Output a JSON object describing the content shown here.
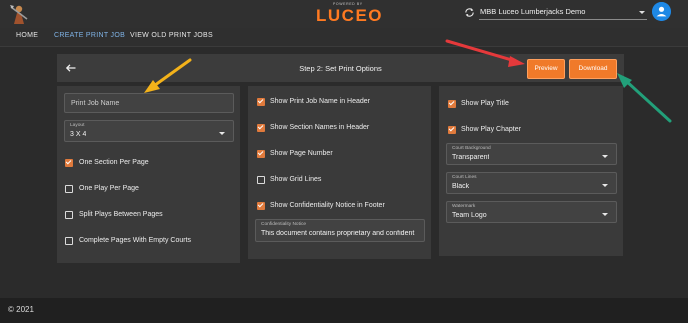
{
  "header": {
    "powered_by": "POWERED BY",
    "brand": "LUCEO",
    "team": "MBB Luceo Lumberjacks Demo"
  },
  "nav": {
    "items": [
      "HOME",
      "CREATE PRINT JOB",
      "VIEW OLD PRINT JOBS"
    ],
    "active_index": 1
  },
  "step": {
    "title": "Step 2: Set Print Options",
    "preview_label": "Preview",
    "download_label": "Download"
  },
  "panel1": {
    "job_name_placeholder": "Print Job Name",
    "layout_label": "Layout",
    "layout_value": "3 X 4",
    "options": [
      {
        "label": "One Section Per Page",
        "checked": true
      },
      {
        "label": "One Play Per Page",
        "checked": false
      },
      {
        "label": "Split Plays Between Pages",
        "checked": false
      },
      {
        "label": "Complete Pages With Empty Courts",
        "checked": false
      }
    ]
  },
  "panel2": {
    "options": [
      {
        "label": "Show Print Job Name in Header",
        "checked": true
      },
      {
        "label": "Show Section Names in Header",
        "checked": true
      },
      {
        "label": "Show Page Number",
        "checked": true
      },
      {
        "label": "Show Grid Lines",
        "checked": false
      },
      {
        "label": "Show Confidentiality Notice in Footer",
        "checked": true
      }
    ],
    "notice_label": "Confidentiality Notice",
    "notice_value": "This document contains proprietary and confident"
  },
  "panel3": {
    "options": [
      {
        "label": "Show Play Title",
        "checked": true
      },
      {
        "label": "Show Play Chapter",
        "checked": true
      }
    ],
    "court_background_label": "Court Background",
    "court_background_value": "Transparent",
    "court_lines_label": "Court Lines",
    "court_lines_value": "Black",
    "watermark_label": "Watermark",
    "watermark_value": "Team Logo"
  },
  "footer": {
    "copyright": "© 2021"
  },
  "colors": {
    "accent": "#ff7a21",
    "button": "#f07a2a",
    "checkbox": "#e07a3c",
    "avatar": "#1e88e5",
    "nav_active": "#7fb3e6",
    "arrow_yellow": "#f3b21a",
    "arrow_red": "#e5393b",
    "arrow_green": "#22a07a"
  },
  "icons": {
    "logo": "lumberjack-mascot-icon",
    "sync": "sync-icon",
    "avatar": "account-circle-icon",
    "back": "arrow-left-icon"
  }
}
